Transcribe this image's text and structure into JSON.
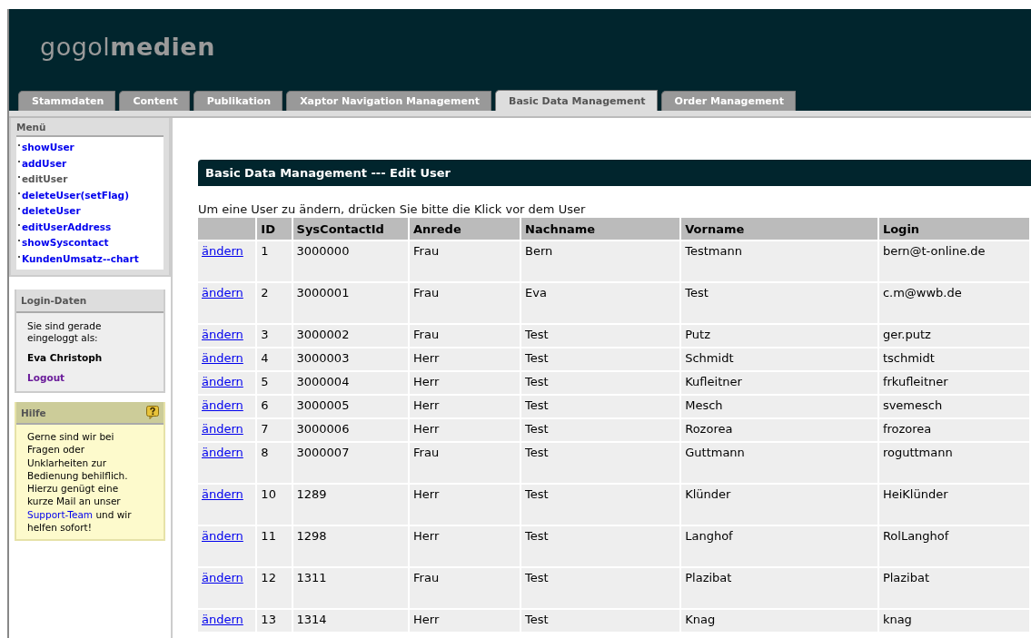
{
  "logo": "gogol**medien**",
  "tabs": [
    {
      "label": "Stammdaten",
      "selected": false
    },
    {
      "label": "Content",
      "selected": false
    },
    {
      "label": "Publikation",
      "selected": false
    },
    {
      "label": "Xaptor Navigation Management",
      "selected": false
    },
    {
      "label": "Basic Data Management",
      "selected": true
    },
    {
      "label": "Order Management",
      "selected": false
    }
  ],
  "menu": {
    "title": "Menü",
    "items": [
      {
        "label": "showUser",
        "selected": false
      },
      {
        "label": "addUser",
        "selected": false
      },
      {
        "label": "editUser",
        "selected": true
      },
      {
        "label": "deleteUser(setFlag)",
        "selected": false
      },
      {
        "label": "deleteUser",
        "selected": false
      },
      {
        "label": "editUserAddress",
        "selected": false
      },
      {
        "label": "showSyscontact",
        "selected": false
      },
      {
        "label": "KundenUmsatz--chart",
        "selected": false
      }
    ]
  },
  "login": {
    "title": "Login-Daten",
    "text": "Sie sind gerade eingeloggt als:",
    "user": "Eva Christoph",
    "logout": "Logout"
  },
  "help": {
    "title": "Hilfe",
    "text_before": "Gerne sind wir bei Fragen oder Unklarheiten zur Bedienung behilflich. Hierzu genügt eine kurze Mail an unser",
    "link": "Support-Team",
    "text_after": "und wir helfen sofort!"
  },
  "heading": "Basic Data Management --- Edit User",
  "instruction": "Um eine User zu ändern, drücken Sie bitte die Klick vor dem User",
  "table": {
    "columns": [
      "ID",
      "SysContactId",
      "Anrede",
      "Nachname",
      "Vorname",
      "Login"
    ],
    "rows": [
      {
        "action": "ändern",
        "cells": [
          "1",
          "3000000",
          "Frau",
          "Bern",
          "Testmann",
          "bern@t-online.de"
        ],
        "tall": true
      },
      {
        "action": "ändern",
        "cells": [
          "2",
          "3000001",
          "Frau",
          "Eva",
          "Test",
          "c.m@wwb.de"
        ],
        "tall": true
      },
      {
        "action": "ändern",
        "cells": [
          "3",
          "3000002",
          "Frau",
          "Test",
          "Putz",
          "ger.putz"
        ],
        "tall": false
      },
      {
        "action": "ändern",
        "cells": [
          "4",
          "3000003",
          "Herr",
          "Test",
          "Schmidt",
          "tschmidt"
        ],
        "tall": false
      },
      {
        "action": "ändern",
        "cells": [
          "5",
          "3000004",
          "Herr",
          "Test",
          "Kufleitner",
          "frkufleitner"
        ],
        "tall": false
      },
      {
        "action": "ändern",
        "cells": [
          "6",
          "3000005",
          "Herr",
          "Test",
          "Mesch",
          "svemesch"
        ],
        "tall": false
      },
      {
        "action": "ändern",
        "cells": [
          "7",
          "3000006",
          "Herr",
          "Test",
          "Rozorea",
          "frozorea"
        ],
        "tall": false
      },
      {
        "action": "ändern",
        "cells": [
          "8",
          "3000007",
          "Frau",
          "Test",
          "Guttmann",
          "roguttmann"
        ],
        "tall": true
      },
      {
        "action": "ändern",
        "cells": [
          "10",
          "1289",
          "Herr",
          "Test",
          "Klünder",
          "HeiKlünder"
        ],
        "tall": true
      },
      {
        "action": "ändern",
        "cells": [
          "11",
          "1298",
          "Herr",
          "Test",
          "Langhof",
          "RolLanghof"
        ],
        "tall": true
      },
      {
        "action": "ändern",
        "cells": [
          "12",
          "1311",
          "Frau",
          "Test",
          "Plazibat",
          "Plazibat"
        ],
        "tall": true
      },
      {
        "action": "ändern",
        "cells": [
          "13",
          "1314",
          "Herr",
          "Test",
          "Knag",
          "knag"
        ],
        "tall": false
      }
    ]
  }
}
